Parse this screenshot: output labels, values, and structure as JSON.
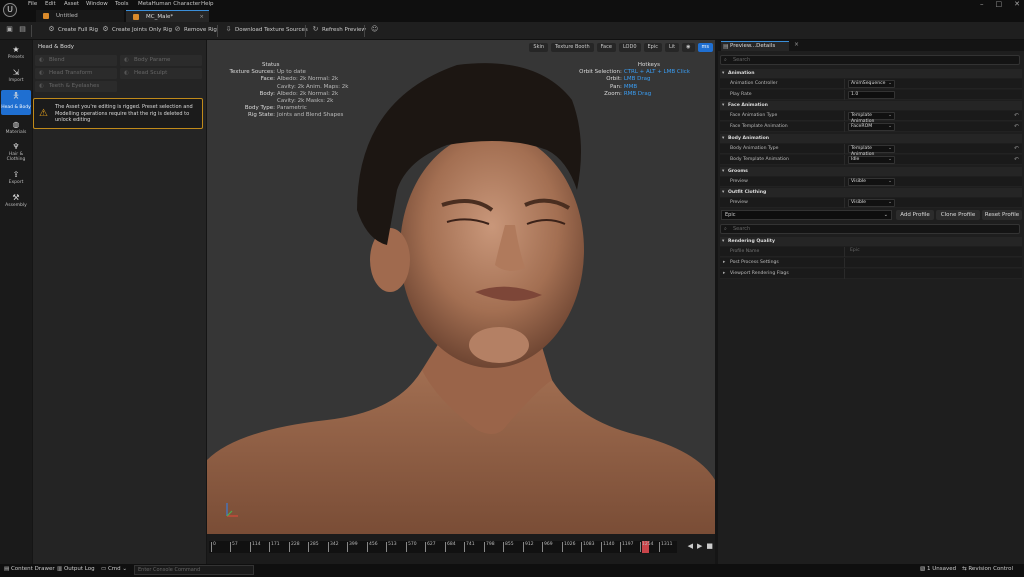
{
  "app": {
    "logo": "U",
    "menu": [
      "File",
      "Edit",
      "Asset",
      "Window",
      "Tools",
      "MetaHuman Character",
      "Help"
    ],
    "window_controls": [
      "–",
      "□",
      "✕"
    ]
  },
  "tabs": [
    {
      "label": "Untitled"
    },
    {
      "label": "MC_Male*"
    }
  ],
  "toolbar": {
    "items": [
      "Create Full Rig",
      "Create Joints Only Rig",
      "Remove Rig",
      "Download Texture Sources",
      "Refresh Preview"
    ]
  },
  "rail": [
    {
      "label": "Presets",
      "icon": "star-icon"
    },
    {
      "label": "Import",
      "icon": "import-icon"
    },
    {
      "label": "Head & Body",
      "icon": "body-icon",
      "active": true
    },
    {
      "label": "Materials",
      "icon": "materials-icon"
    },
    {
      "label": "Hair & Clothing",
      "icon": "hair-icon"
    },
    {
      "label": "Export",
      "icon": "export-icon"
    },
    {
      "label": "Assembly",
      "icon": "hammer-icon"
    }
  ],
  "left_panel": {
    "title": "Head & Body",
    "categories": [
      "Blend",
      "Body Parame",
      "Head Transform",
      "Head Sculpt",
      "Teeth & Eyelashes"
    ],
    "warning": "The Asset you're editing is rigged. Preset selection and Modelling operations require that the rig is deleted to unlock editing"
  },
  "viewport": {
    "buttons": [
      "Skin",
      "Texture Booth",
      "Face",
      "LOD0",
      "Epic",
      "Lit",
      "",
      "ms"
    ],
    "status_title": "Status",
    "status": [
      {
        "k": "Texture Sources:",
        "v": "Up to date"
      },
      {
        "k": "Face:",
        "v": "Albedo: 2k Normal: 2k"
      },
      {
        "k": "",
        "v": "Cavity: 2k Anim. Maps: 2k"
      },
      {
        "k": "Body:",
        "v": "Albedo: 2k Normal: 2k"
      },
      {
        "k": "",
        "v": "Cavity: 2k Masks: 2k"
      },
      {
        "k": "Body Type:",
        "v": "Parametric"
      },
      {
        "k": "Rig State:",
        "v": "Joints and Blend Shapes"
      }
    ],
    "hotkeys_title": "Hotkeys",
    "hotkeys": [
      {
        "k": "Orbit Selection:",
        "v": "CTRL + ALT + LMB Click"
      },
      {
        "k": "Orbit:",
        "v": "LMB Drag"
      },
      {
        "k": "Pan:",
        "v": "MMB"
      },
      {
        "k": "Zoom:",
        "v": "RMB Drag"
      }
    ]
  },
  "timeline": {
    "ticks": [
      "0",
      "57",
      "114",
      "171",
      "228",
      "285",
      "342",
      "399",
      "456",
      "513",
      "570",
      "627",
      "684",
      "741",
      "798",
      "855",
      "912",
      "969",
      "1026",
      "1083",
      "1140",
      "1197",
      "1254",
      "1311"
    ],
    "playhead_frame": 1254
  },
  "bottom": {
    "content_drawer": "Content Drawer",
    "output_log": "Output Log",
    "cmd": "Cmd",
    "cmd_placeholder": "Enter Console Command",
    "unsaved": "1 Unsaved",
    "revision": "Revision Control"
  },
  "details": {
    "tab": "Preview...Details",
    "search_placeholder": "Search",
    "sections": {
      "animation": {
        "title": "Animation",
        "controller_label": "Animation Controller",
        "controller_value": "AnimSequence",
        "rate_label": "Play Rate",
        "rate_value": "1.0"
      },
      "face_anim": {
        "title": "Face Animation",
        "type_label": "Face Animation Type",
        "type_value": "Template Animation",
        "tmpl_label": "Face Template Animation",
        "tmpl_value": "FaceROM"
      },
      "body_anim": {
        "title": "Body Animation",
        "type_label": "Body Animation Type",
        "type_value": "Template Animation",
        "tmpl_label": "Body Template Animation",
        "tmpl_value": "Idle"
      },
      "grooms": {
        "title": "Grooms",
        "preview_label": "Preview",
        "preview_value": "Visible"
      },
      "outfit": {
        "title": "Outfit Clothing",
        "preview_label": "Preview",
        "preview_value": "Visible"
      }
    },
    "profile": {
      "value": "Epic",
      "add": "Add Profile",
      "clone": "Clone Profile",
      "reset": "Reset Profile"
    },
    "search2_placeholder": "Search",
    "rendering": {
      "title": "Rendering Quality",
      "profile_name_label": "Profile Name",
      "profile_name_value": "Epic",
      "post": "Post Process Settings",
      "flags": "Viewport Rendering Flags"
    }
  }
}
